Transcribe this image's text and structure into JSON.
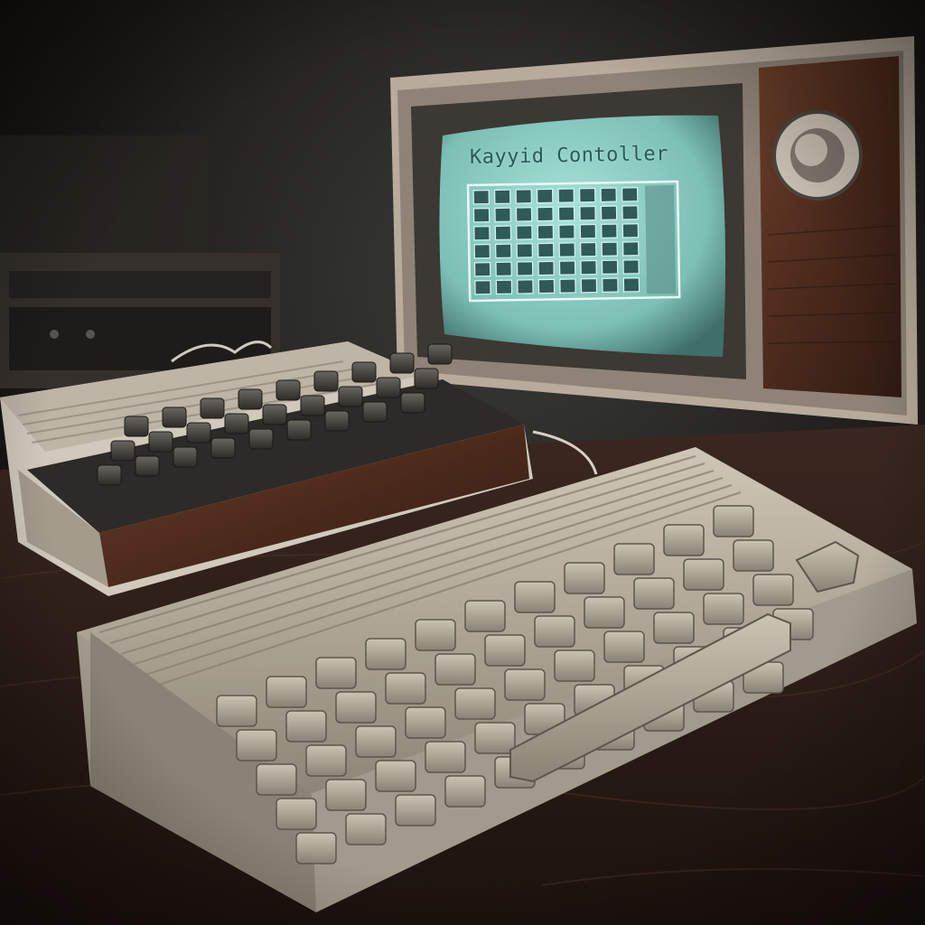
{
  "screen": {
    "title": "Kayyid Contoller",
    "caption": "",
    "grid_rows": 6,
    "grid_cols": 8
  },
  "colors": {
    "screen_glow": "#8fd1c6",
    "wood": "#5b3322",
    "plastic": "#b9b0a2",
    "desk": "#2a1c17"
  },
  "objects": {
    "monitor": "crt-monitor",
    "keypad": "keypad-controller",
    "keyboard": "retro-keyboard"
  }
}
